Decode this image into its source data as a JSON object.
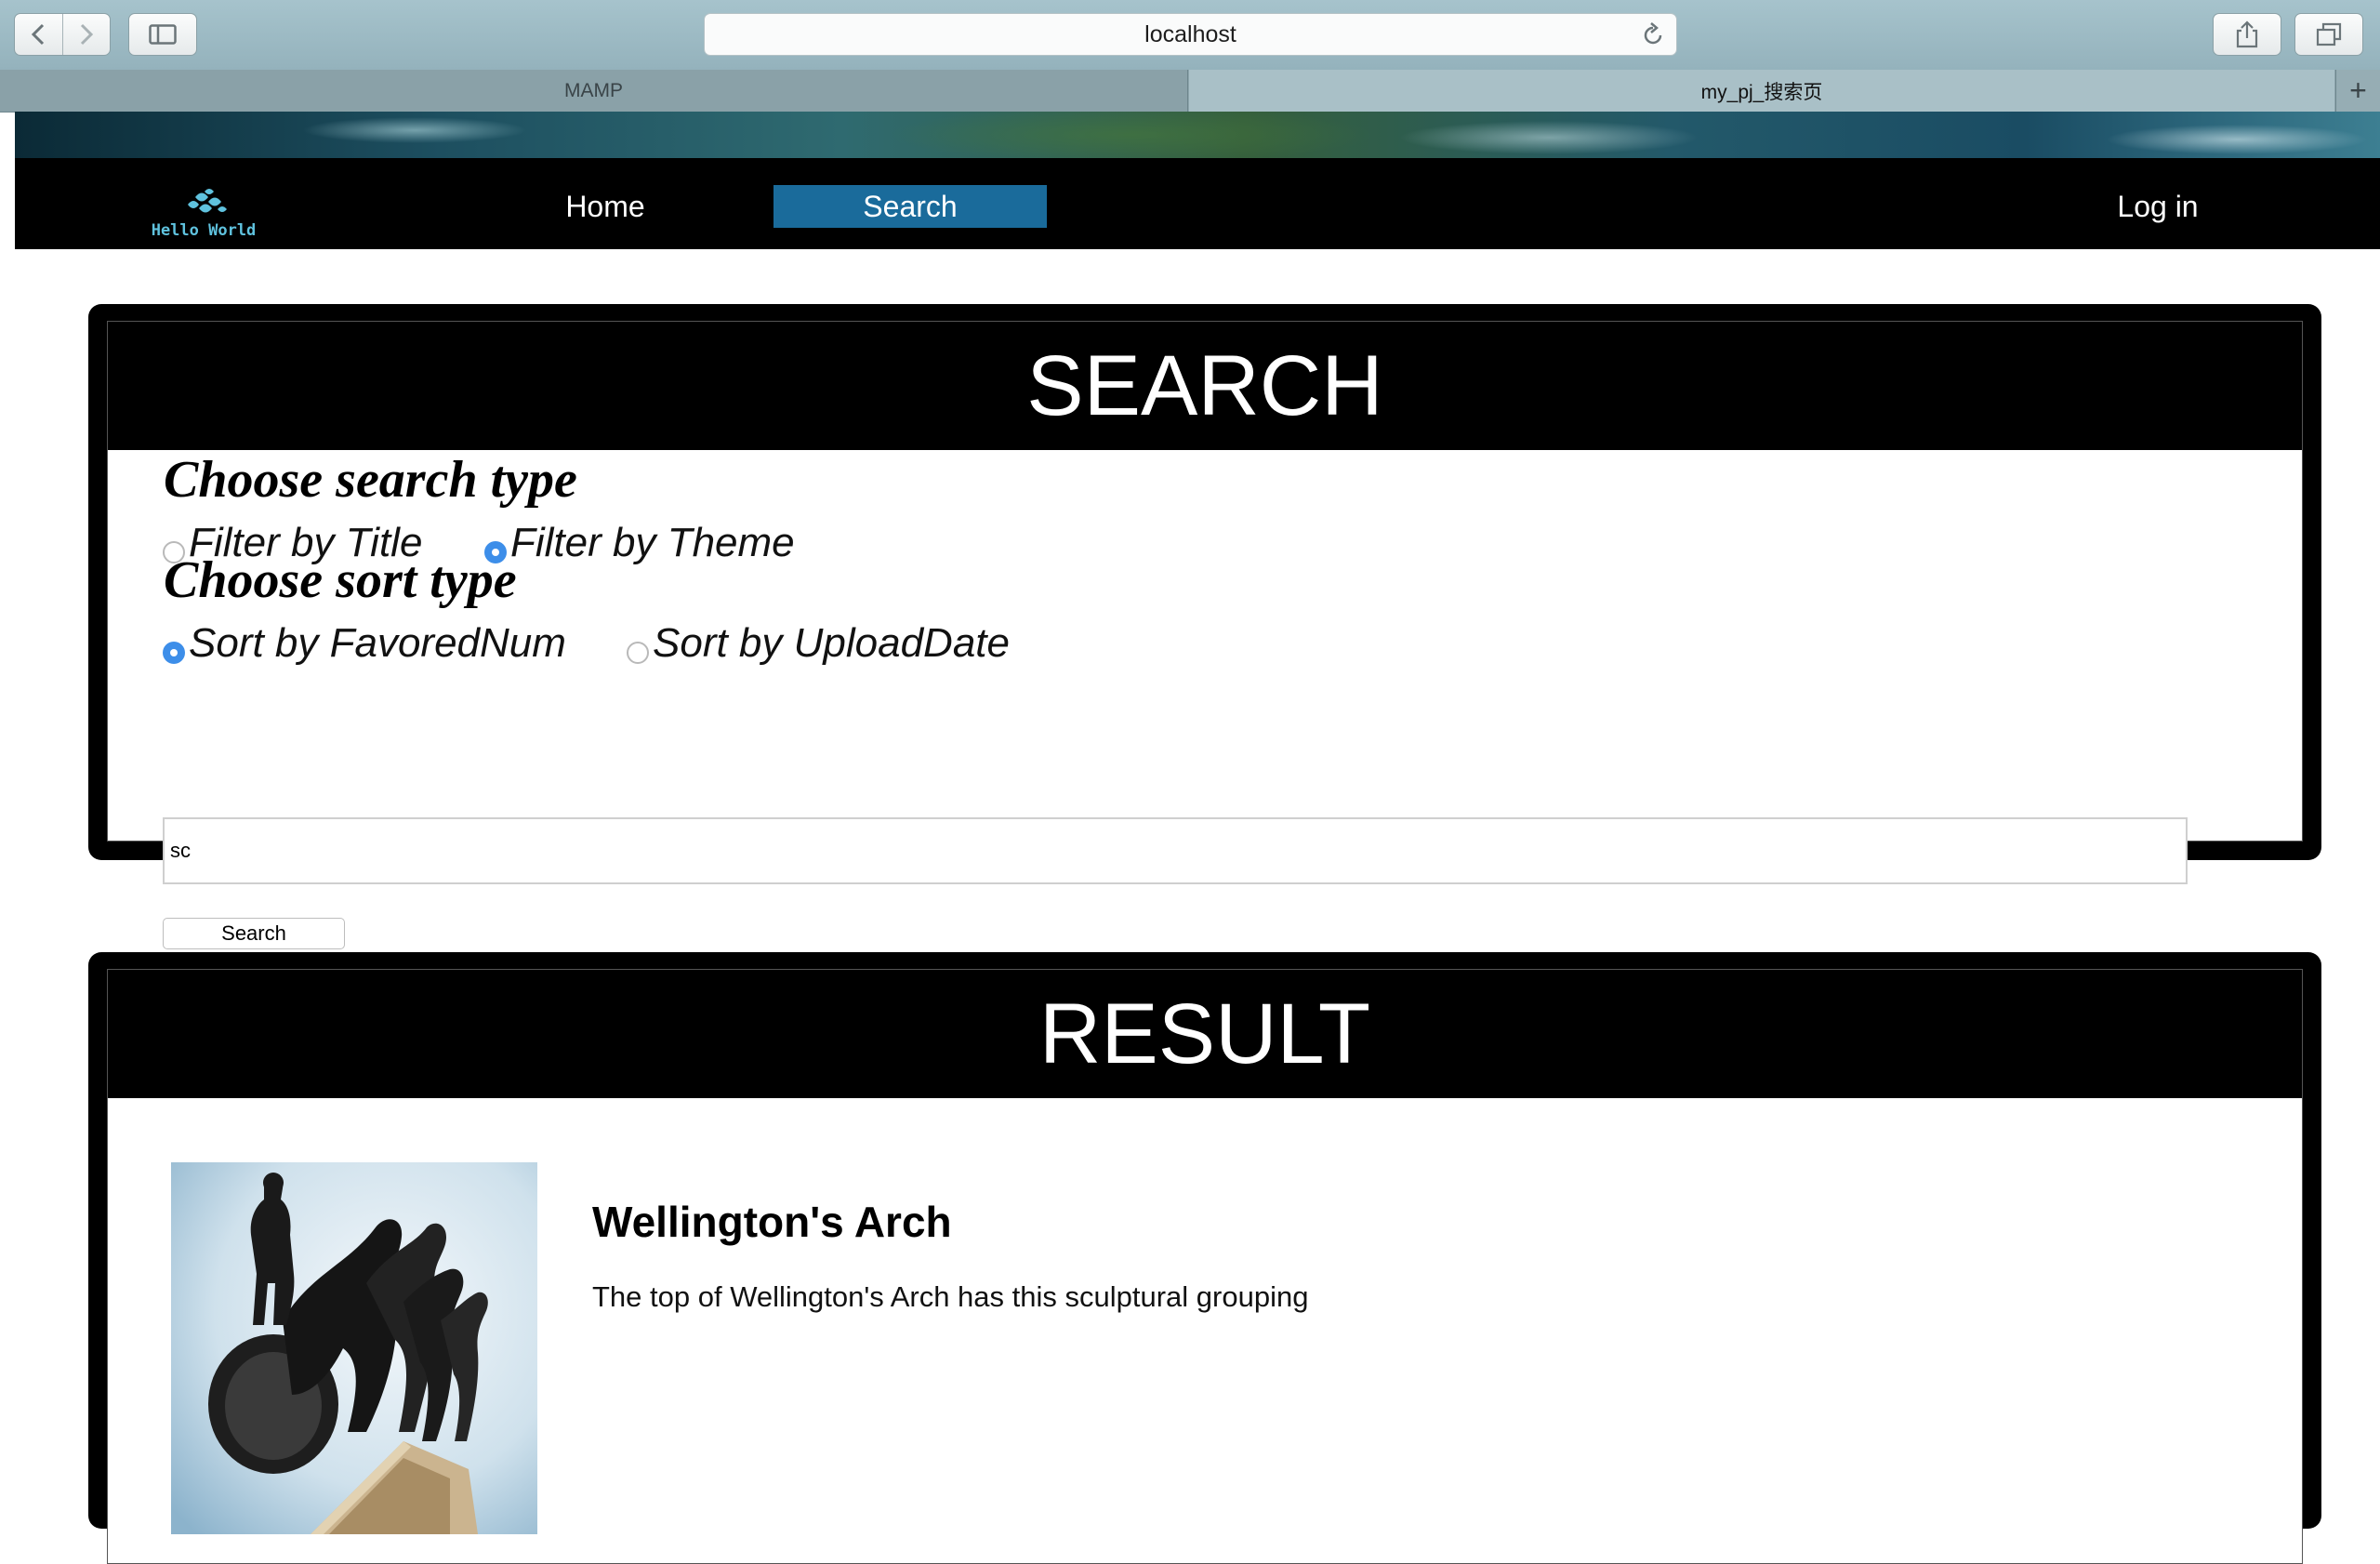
{
  "browser": {
    "url": "localhost",
    "tabs": [
      {
        "label": "MAMP",
        "active": false
      },
      {
        "label": "my_pj_搜索页",
        "active": true
      }
    ],
    "new_tab_label": "+"
  },
  "navbar": {
    "logo_text": "Hello World",
    "links": {
      "home": "Home",
      "search": "Search",
      "login": "Log in"
    },
    "active_link": "search",
    "active_color": "#1a6b9b"
  },
  "search": {
    "heading": "SEARCH",
    "search_type": {
      "title": "Choose search type",
      "options": [
        "Filter by Title",
        "Filter by Theme"
      ],
      "selected": "Filter by Theme"
    },
    "sort_type": {
      "title": "Choose sort type",
      "options": [
        "Sort by FavoredNum",
        "Sort by UploadDate"
      ],
      "selected": "Sort by FavoredNum"
    },
    "query": "sc",
    "submit_label": "Search"
  },
  "result": {
    "heading": "RESULT",
    "items": [
      {
        "title": "Wellington's Arch",
        "description": "The top of Wellington's Arch has this sculptural grouping",
        "image": "sculpture-photo"
      }
    ]
  }
}
